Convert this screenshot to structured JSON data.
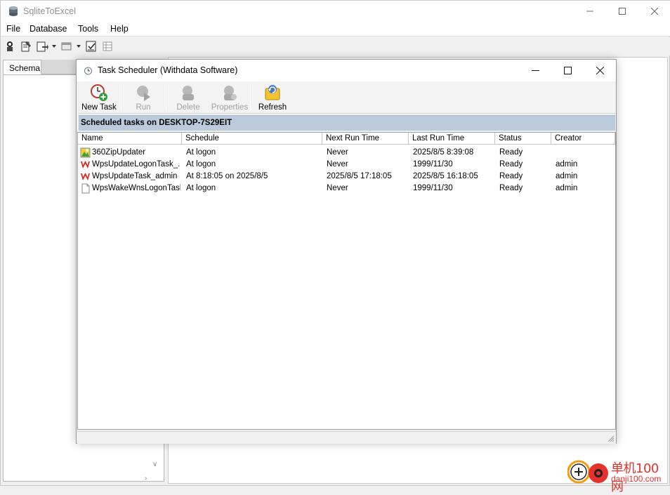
{
  "app": {
    "title": "SqliteToExcel",
    "menu": [
      "File",
      "Database",
      "Tools",
      "Help"
    ],
    "left_tab": "Schema"
  },
  "dialog": {
    "title": "Task Scheduler (Withdata Software)",
    "toolbar": {
      "new_task": "New Task",
      "run": "Run",
      "delete": "Delete",
      "properties": "Properties",
      "refresh": "Refresh"
    },
    "banner": "Scheduled tasks on DESKTOP-7S29EIT",
    "columns": [
      "Name",
      "Schedule",
      "Next Run Time",
      "Last Run Time",
      "Status",
      "Creator"
    ],
    "tasks": [
      {
        "icon": "update-icon",
        "name": "360ZipUpdater",
        "schedule": "At logon",
        "next": "Never",
        "last": "2025/8/5 8:39:08",
        "status": "Ready",
        "creator": ""
      },
      {
        "icon": "wps-icon",
        "name": "WpsUpdateLogonTask_...",
        "schedule": "At logon",
        "next": "Never",
        "last": "1999/11/30",
        "status": "Ready",
        "creator": "admin"
      },
      {
        "icon": "wps-icon",
        "name": "WpsUpdateTask_admin",
        "schedule": "At 8:18:05 on 2025/8/5",
        "next": "2025/8/5 17:18:05",
        "last": "2025/8/5 16:18:05",
        "status": "Ready",
        "creator": "admin"
      },
      {
        "icon": "file-icon",
        "name": "WpsWakeWnsLogonTask",
        "schedule": "At logon",
        "next": "Never",
        "last": "1999/11/30",
        "status": "Ready",
        "creator": "admin"
      }
    ]
  },
  "watermark": {
    "cn": "单机100网",
    "url": "danji100.com"
  },
  "colors": {
    "banner": "#bccbdb",
    "wps_red": "#d9261c",
    "watermark": "#e5322d"
  }
}
